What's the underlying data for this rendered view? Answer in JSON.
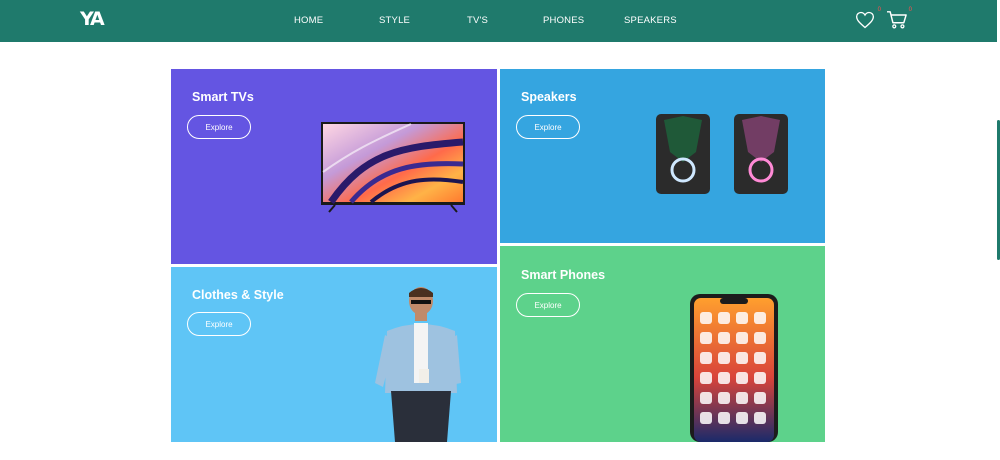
{
  "brand": {
    "logo": "YA"
  },
  "nav": {
    "items": [
      "HOME",
      "STYLE",
      "TV'S",
      "PHONES",
      "SPEAKERS"
    ]
  },
  "header_icons": {
    "wishlist_count": "0",
    "cart_count": "0"
  },
  "colors": {
    "header": "#1f7a6c",
    "tvs_card": "#6455e2",
    "speakers_card": "#35a5e0",
    "clothes_card": "#5fc5f6",
    "phones_card": "#5dd28b"
  },
  "categories": {
    "tvs": {
      "title": "Smart TVs",
      "button": "Explore"
    },
    "speakers": {
      "title": "Speakers",
      "button": "Explore"
    },
    "clothes": {
      "title": "Clothes & Style",
      "button": "Explore"
    },
    "phones": {
      "title": "Smart Phones",
      "button": "Explore"
    }
  }
}
